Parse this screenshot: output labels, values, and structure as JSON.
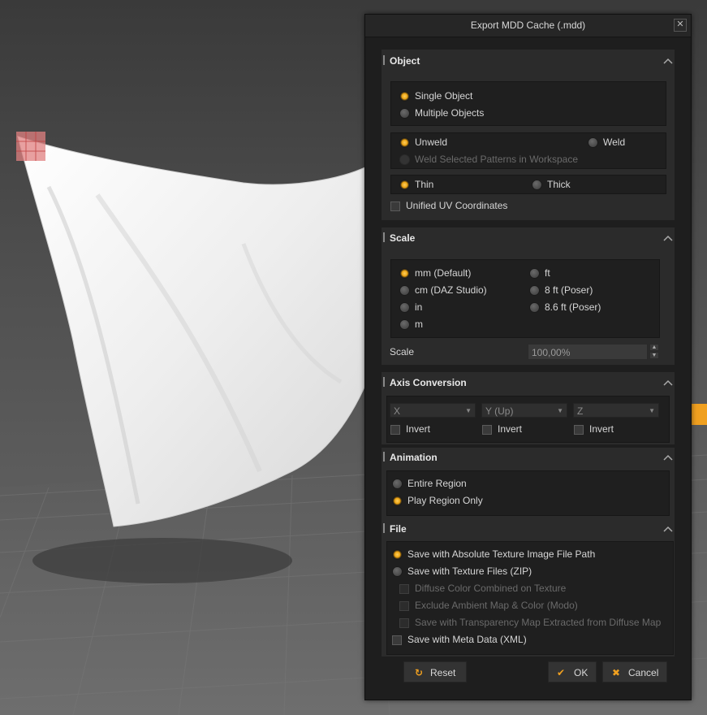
{
  "dialog": {
    "title": "Export MDD Cache (.mdd)",
    "close_glyph": "✕"
  },
  "object": {
    "title": "Object",
    "single_object": "Single Object",
    "multiple_objects": "Multiple Objects",
    "unweld": "Unweld",
    "weld": "Weld",
    "weld_selected": "Weld Selected Patterns in Workspace",
    "thin": "Thin",
    "thick": "Thick",
    "unified_uv": "Unified UV Coordinates"
  },
  "scale": {
    "title": "Scale",
    "mm": "mm (Default)",
    "cm": "cm (DAZ Studio)",
    "in": "in",
    "m": "m",
    "ft": "ft",
    "ft8": "8 ft (Poser)",
    "ft86": "8.6 ft (Poser)",
    "scale_label": "Scale",
    "scale_value": "100,00%"
  },
  "axis": {
    "title": "Axis Conversion",
    "x_value": "X",
    "y_value": "Y (Up)",
    "z_value": "Z",
    "invert": "Invert"
  },
  "animation": {
    "title": "Animation",
    "entire_region": "Entire Region",
    "play_region_only": "Play Region Only"
  },
  "file": {
    "title": "File",
    "abs_path": "Save with Absolute Texture Image File Path",
    "texture_zip": "Save with Texture Files (ZIP)",
    "diffuse_combined": "Diffuse Color Combined on Texture",
    "exclude_ambient": "Exclude Ambient Map & Color (Modo)",
    "transparency_map": "Save with Transparency Map Extracted from Diffuse Map",
    "meta_data": "Save with Meta Data (XML)"
  },
  "buttons": {
    "reset": "Reset",
    "ok": "OK",
    "cancel": "Cancel"
  },
  "colors": {
    "accent": "#f0a020",
    "panel": "#2b2b2b",
    "dialog_bg": "#1e1e1e"
  }
}
